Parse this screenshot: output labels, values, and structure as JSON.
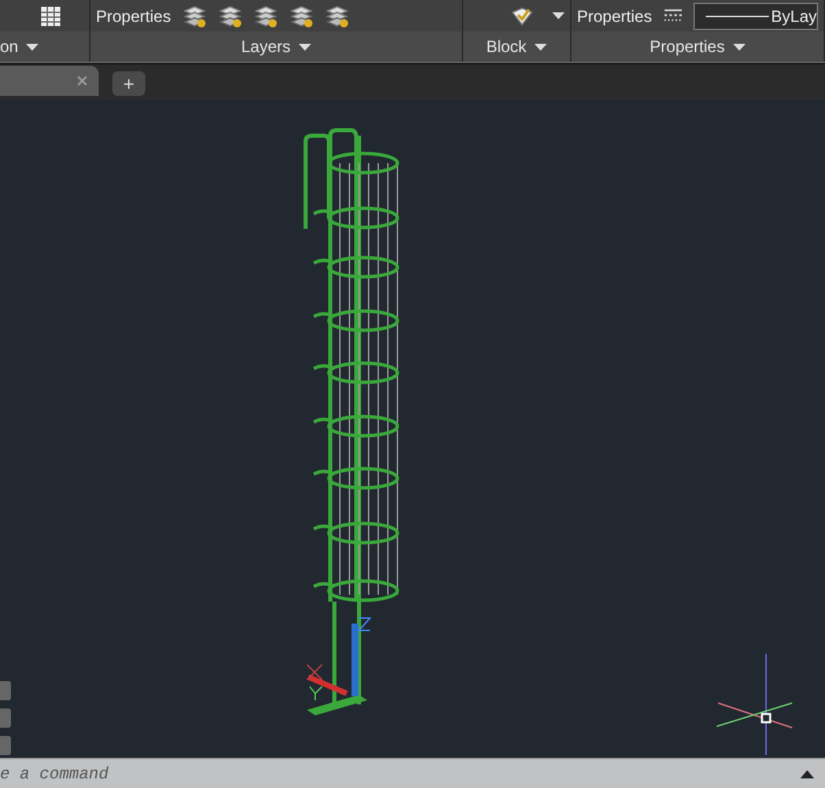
{
  "ribbon": {
    "panels": [
      {
        "label": "on",
        "buttons": [
          {
            "kind": "table"
          }
        ]
      },
      {
        "label": "Layers",
        "buttons": [
          {
            "kind": "text",
            "label": "Properties"
          },
          {
            "kind": "layer"
          },
          {
            "kind": "layer"
          },
          {
            "kind": "layer"
          },
          {
            "kind": "layer"
          },
          {
            "kind": "layer"
          }
        ]
      },
      {
        "label": "Block",
        "buttons": [
          {
            "kind": "block"
          }
        ]
      },
      {
        "label": "Properties",
        "buttons": [
          {
            "kind": "text",
            "label": "Properties"
          },
          {
            "kind": "linetype"
          },
          {
            "kind": "dropdown",
            "label": "ByLay"
          }
        ]
      }
    ]
  },
  "tabs": [
    {
      "kind": "file",
      "selected": true
    },
    {
      "kind": "new",
      "label": "+",
      "selected": false
    }
  ],
  "command_line": {
    "placeholder": "e a command"
  }
}
